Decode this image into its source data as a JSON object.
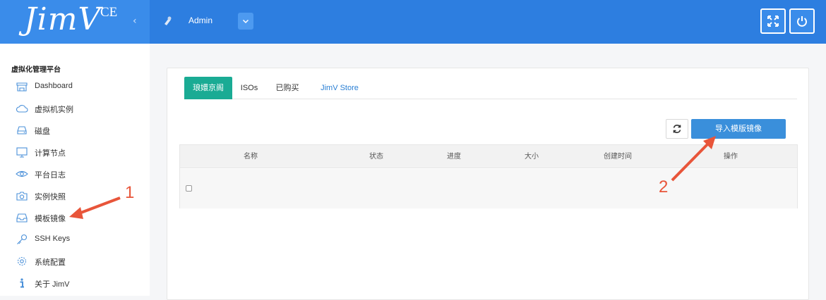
{
  "header": {
    "logo": "JimV",
    "edition": "CE",
    "collapse_glyph": "‹",
    "user": {
      "name": "Admin"
    },
    "buttons": [
      {
        "icon": "fullscreen-icon"
      },
      {
        "icon": "power-icon"
      }
    ]
  },
  "sidebar": {
    "title": "虚拟化管理平台",
    "items": [
      {
        "label": "Dashboard",
        "icon": "dashboard-icon"
      },
      {
        "label": "虚拟机实例",
        "icon": "cloud-icon"
      },
      {
        "label": "磁盘",
        "icon": "disk-icon"
      },
      {
        "label": "计算节点",
        "icon": "monitor-icon"
      },
      {
        "label": "平台日志",
        "icon": "eye-icon"
      },
      {
        "label": "实例快照",
        "icon": "camera-icon"
      },
      {
        "label": "模板镜像",
        "icon": "inbox-icon"
      },
      {
        "label": "SSH Keys",
        "icon": "key-icon"
      },
      {
        "label": "系统配置",
        "icon": "gear-icon"
      },
      {
        "label": "关于 JimV",
        "icon": "info-icon"
      }
    ]
  },
  "main": {
    "tabs": [
      {
        "label": "琅嬛京阁",
        "active": true
      },
      {
        "label": "ISOs",
        "active": false
      },
      {
        "label": "已购买",
        "active": false
      },
      {
        "label": "JimV Store",
        "active": false,
        "link": true
      }
    ],
    "toolbar": {
      "refresh_icon": "refresh-icon",
      "import_label": "导入模版镜像"
    },
    "table": {
      "columns": [
        "名称",
        "状态",
        "进度",
        "大小",
        "创建时间",
        "操作"
      ],
      "rows": []
    }
  },
  "annotations": [
    {
      "label": "1"
    },
    {
      "label": "2"
    }
  ],
  "colors": {
    "topbar": "#2d7ee0",
    "brand": "#3a8cea",
    "active_tab": "#1aab94",
    "primary_button": "#3a8fdb",
    "annotation": "#e8553a"
  }
}
